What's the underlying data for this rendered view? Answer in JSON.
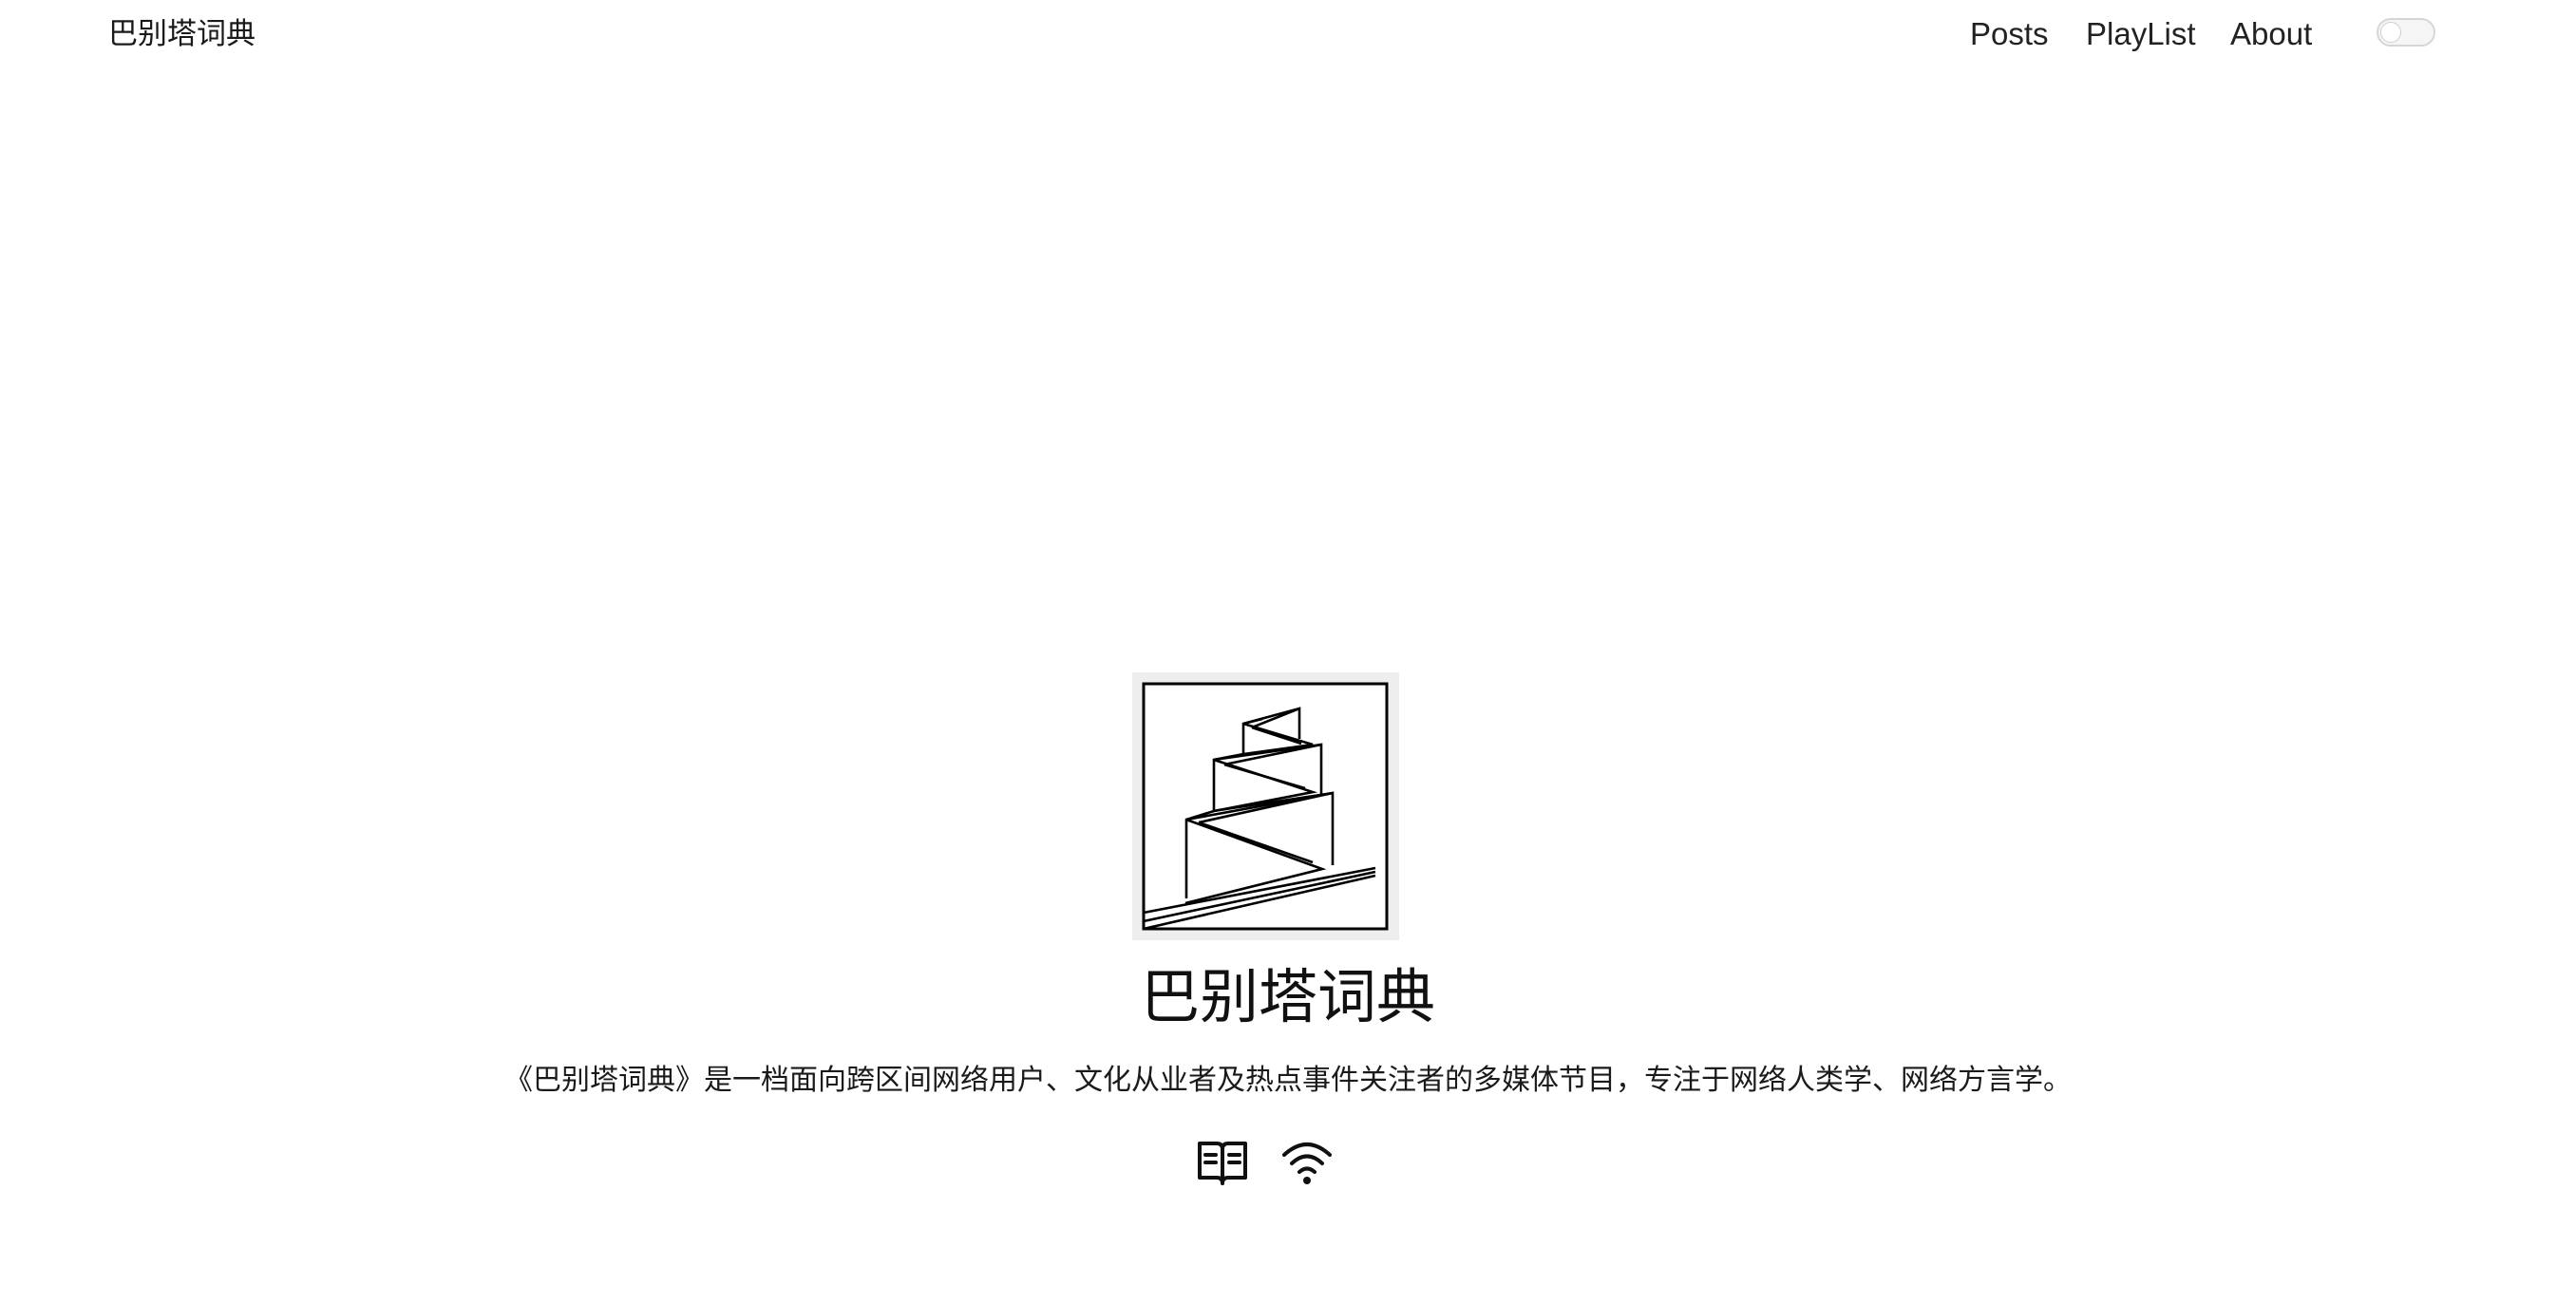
{
  "header": {
    "site_title": "巴别塔词典",
    "nav": [
      {
        "label": "Posts"
      },
      {
        "label": "PlayList"
      },
      {
        "label": "About"
      }
    ],
    "theme_toggle": {
      "state": "off",
      "icon": "theme-toggle-switch"
    }
  },
  "profile": {
    "logo_icon": "babel-tower-logo",
    "title": "巴别塔词典",
    "description": "《巴别塔词典》是一档面向跨区间网络用户、文化从业者及热点事件关注者的多媒体节目，专注于网络人类学、网络方言学。",
    "social_icons": [
      {
        "icon": "book-icon"
      },
      {
        "icon": "rss-wifi-icon"
      }
    ]
  },
  "colors": {
    "background": "#ffffff",
    "text": "#111111",
    "logo_frame": "#eeeeee"
  }
}
